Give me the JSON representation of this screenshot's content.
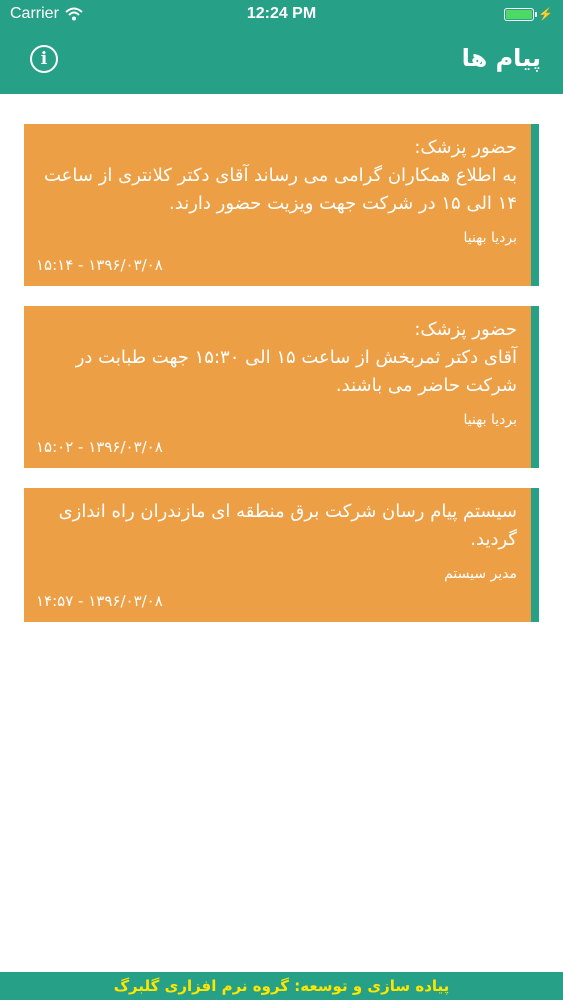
{
  "statusbar": {
    "carrier": "Carrier",
    "time": "12:24 PM",
    "icons": [
      "wifi-icon",
      "battery-icon",
      "charging-bolt-icon"
    ]
  },
  "header": {
    "title": "پیام ها",
    "info_icon": "info-icon"
  },
  "messages": [
    {
      "text": "حضور پزشک:\nبه اطلاع همکاران گرامی می رساند آقای دکتر کلانتری از ساعت ۱۴ الی ۱۵ در شرکت جهت ویزیت حضور دارند.",
      "sender": "بردیا بهنیا",
      "date": "۱۵:۱۴ - ۱۳۹۶/۰۳/۰۸"
    },
    {
      "text": "حضور پزشک:\nآقای دکتر ثمربخش از ساعت ۱۵ الی ۱۵:۳۰ جهت طبابت در شرکت حاضر می باشند.",
      "sender": "بردیا بهنیا",
      "date": "۱۵:۰۲ - ۱۳۹۶/۰۳/۰۸"
    },
    {
      "text": "سیستم پیام رسان شرکت برق منطقه ای مازندران راه اندازی گردید.",
      "sender": "مدیر سیستم",
      "date": "۱۴:۵۷ - ۱۳۹۶/۰۳/۰۸"
    }
  ],
  "footer": {
    "credit": "پیاده سازی و توسعه: گروه نرم افزاری گلبرگ"
  },
  "colors": {
    "primary": "#26a087",
    "card": "#ec9f45",
    "footer_text": "#ffe600"
  }
}
